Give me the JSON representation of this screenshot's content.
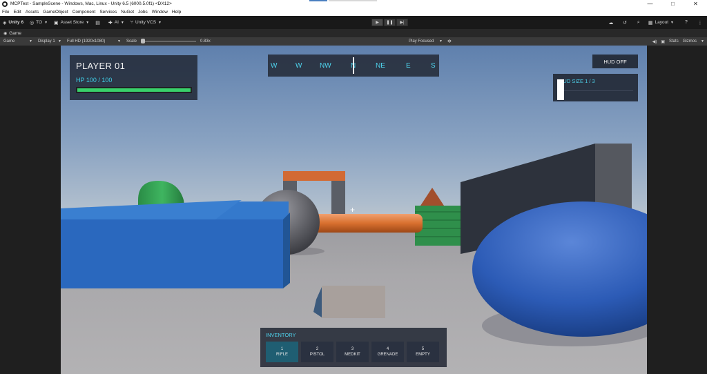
{
  "window": {
    "title": "MCPTest - SampleScene - Windows, Mac, Linux - Unity 6.5 (6000.5.0f1) <DX12>",
    "controls": {
      "minimize": "—",
      "maximize": "□",
      "close": "✕"
    }
  },
  "menu": [
    "File",
    "Edit",
    "Assets",
    "GameObject",
    "Component",
    "Services",
    "NuGet",
    "Jobs",
    "Window",
    "Help"
  ],
  "toolbar": {
    "account": "Unity 6",
    "org": "TO",
    "asset_store": "Asset Store",
    "ai": "AI",
    "vcs": "Unity VCS",
    "layout": "Layout",
    "play_icons": [
      "play-icon",
      "pause-icon",
      "step-icon"
    ]
  },
  "game_tab": {
    "label": "Game"
  },
  "game_bar": {
    "mode": "Game",
    "display": "Display 1",
    "resolution": "Full HD (1920x1080)",
    "scale_label": "Scale",
    "scale_value": "0.83x",
    "play_focused": "Play Focused",
    "stats": "Stats",
    "gizmos": "Gizmos",
    "scale": 0.0
  },
  "hud": {
    "player_name": "PLAYER 01",
    "hp_text": "HP  100 / 100",
    "hp_fraction": 1.0,
    "compass": [
      "W",
      "W",
      "NW",
      "N",
      "NE",
      "E",
      "S"
    ],
    "hud_toggle": "HUD OFF",
    "hud_size_label": "HUD SIZE  1 / 3",
    "crosshair": "+"
  },
  "inventory": {
    "title": "INVENTORY",
    "selected_index": 0,
    "slots": [
      {
        "num": "1",
        "name": "RIFLE"
      },
      {
        "num": "2",
        "name": "PISTOL"
      },
      {
        "num": "3",
        "name": "MEDKIT"
      },
      {
        "num": "4",
        "name": "GRENADE"
      },
      {
        "num": "5",
        "name": "EMPTY"
      }
    ]
  },
  "colors": {
    "accent_cyan": "#4fd5ef",
    "hp_green": "#39d16a",
    "slot_selected": "#1f5e72",
    "hud_panel": "#262e3c"
  }
}
